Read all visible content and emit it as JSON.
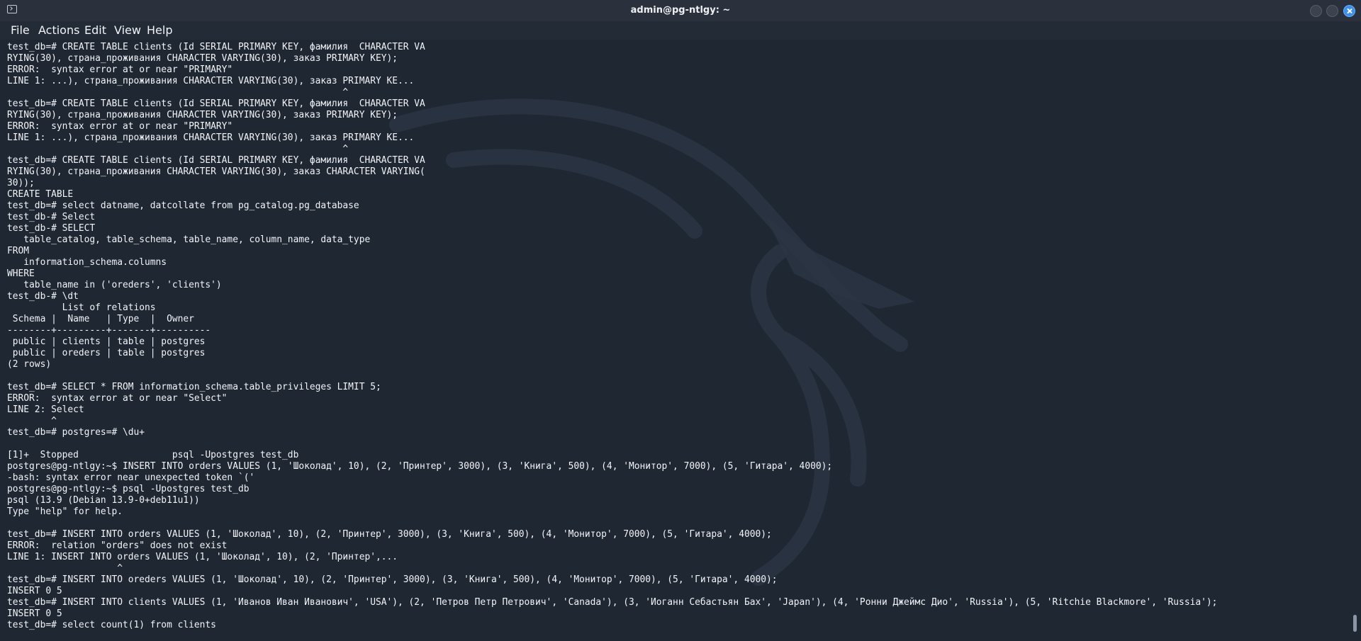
{
  "window": {
    "title": "admin@pg-ntlgy: ~",
    "icon": "terminal-icon",
    "controls": [
      "minimize-icon",
      "maximize-icon",
      "close-icon"
    ],
    "accent_color": "#3e8fe8"
  },
  "menu": {
    "file": "File",
    "actions": "Actions",
    "edit": "Edit",
    "view": "View",
    "help": "Help"
  },
  "terminal": {
    "background_color": "#1f2733",
    "text_color": "#f2f4f7",
    "lines": [
      "test_db=# CREATE TABLE clients (Id SERIAL PRIMARY KEY, фамилия  CHARACTER VA",
      "RYING(30), страна_проживания CHARACTER VARYING(30), заказ PRIMARY KEY);",
      "ERROR:  syntax error at or near \"PRIMARY\"",
      "LINE 1: ...), страна_проживания CHARACTER VARYING(30), заказ PRIMARY KE...",
      "                                                             ^",
      "test_db=# CREATE TABLE clients (Id SERIAL PRIMARY KEY, фамилия  CHARACTER VA",
      "RYING(30), страна_проживания CHARACTER VARYING(30), заказ PRIMARY KEY);",
      "ERROR:  syntax error at or near \"PRIMARY\"",
      "LINE 1: ...), страна_проживания CHARACTER VARYING(30), заказ PRIMARY KE...",
      "                                                             ^",
      "test_db=# CREATE TABLE clients (Id SERIAL PRIMARY KEY, фамилия  CHARACTER VA",
      "RYING(30), страна_проживания CHARACTER VARYING(30), заказ CHARACTER VARYING(",
      "30));",
      "CREATE TABLE",
      "test_db=# select datname, datcollate from pg_catalog.pg_database",
      "test_db-# Select",
      "test_db-# SELECT",
      "   table_catalog, table_schema, table_name, column_name, data_type",
      "FROM",
      "   information_schema.columns",
      "WHERE",
      "   table_name in ('oreders', 'clients')",
      "test_db-# \\dt",
      "          List of relations",
      " Schema |  Name   | Type  |  Owner",
      "--------+---------+-------+----------",
      " public | clients | table | postgres",
      " public | oreders | table | postgres",
      "(2 rows)",
      "",
      "test_db=# SELECT * FROM information_schema.table_privileges LIMIT 5;",
      "ERROR:  syntax error at or near \"Select\"",
      "LINE 2: Select",
      "        ^",
      "test_db=# postgres=# \\du+",
      "",
      "[1]+  Stopped                 psql -Upostgres test_db",
      "postgres@pg-ntlgy:~$ INSERT INTO orders VALUES (1, 'Шоколад', 10), (2, 'Принтер', 3000), (3, 'Книга', 500), (4, 'Монитор', 7000), (5, 'Гитара', 4000);",
      "-bash: syntax error near unexpected token `('",
      "postgres@pg-ntlgy:~$ psql -Upostgres test_db",
      "psql (13.9 (Debian 13.9-0+deb11u1))",
      "Type \"help\" for help.",
      "",
      "test_db=# INSERT INTO orders VALUES (1, 'Шоколад', 10), (2, 'Принтер', 3000), (3, 'Книга', 500), (4, 'Монитор', 7000), (5, 'Гитара', 4000);",
      "ERROR:  relation \"orders\" does not exist",
      "LINE 1: INSERT INTO orders VALUES (1, 'Шоколад', 10), (2, 'Принтер',...",
      "                    ^",
      "test_db=# INSERT INTO oreders VALUES (1, 'Шоколад', 10), (2, 'Принтер', 3000), (3, 'Книга', 500), (4, 'Монитор', 7000), (5, 'Гитара', 4000);",
      "INSERT 0 5",
      "test_db=# INSERT INTO clients VALUES (1, 'Иванов Иван Иванович', 'USA'), (2, 'Петров Петр Петрович', 'Canada'), (3, 'Иоганн Себастьян Бах', 'Japan'), (4, 'Ронни Джеймс Дио', 'Russia'), (5, 'Ritchie Blackmore', 'Russia');",
      "INSERT 0 5",
      "test_db=# select count(1) from clients"
    ]
  }
}
